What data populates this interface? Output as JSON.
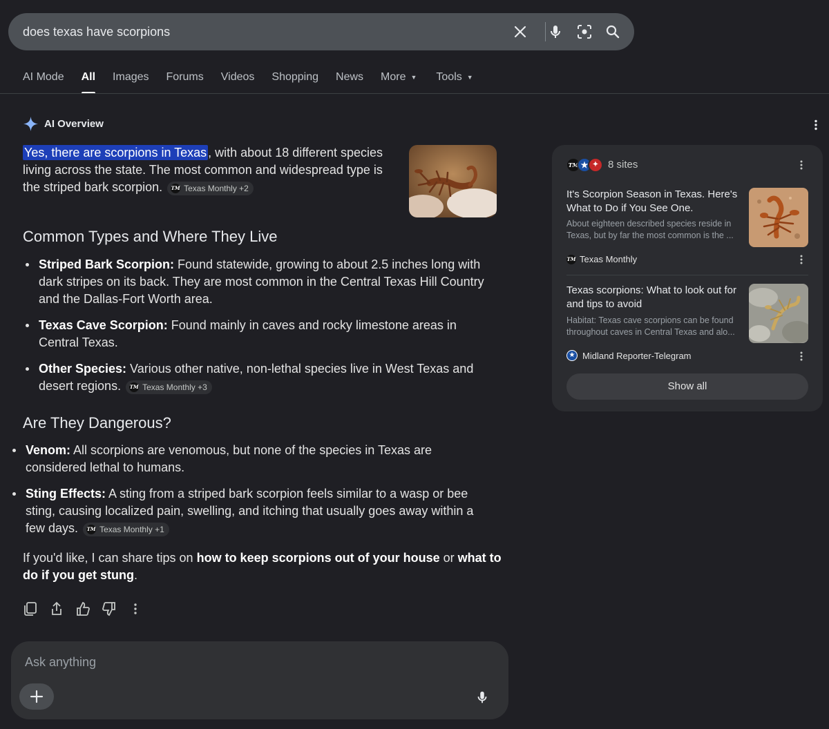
{
  "search": {
    "query": "does texas have scorpions"
  },
  "tabs": [
    {
      "label": "AI Mode"
    },
    {
      "label": "All"
    },
    {
      "label": "Images"
    },
    {
      "label": "Forums"
    },
    {
      "label": "Videos"
    },
    {
      "label": "Shopping"
    },
    {
      "label": "News"
    },
    {
      "label": "More"
    },
    {
      "label": "Tools"
    }
  ],
  "overview": {
    "title": "AI Overview",
    "intro_highlight": "Yes, there are scorpions in Texas",
    "intro_rest": ", with about 18 different species living across the state. The most common and widespread type is the striped bark scorpion.",
    "intro_cite": "Texas Monthly +2",
    "section1_title": "Common Types and Where They Live",
    "types": [
      {
        "term": "Striped Bark Scorpion:",
        "text": " Found statewide, growing to about 2.5 inches long with dark stripes on its back. They are most common in the Central Texas Hill Country and the Dallas-Fort Worth area.",
        "cite": ""
      },
      {
        "term": "Texas Cave Scorpion:",
        "text": " Found mainly in caves and rocky limestone areas in Central Texas.",
        "cite": ""
      },
      {
        "term": "Other Species:",
        "text": " Various other native, non-lethal species live in West Texas and desert regions.",
        "cite": "Texas Monthly +3"
      }
    ],
    "section2_title": "Are They Dangerous?",
    "dangers": [
      {
        "term": "Venom:",
        "text": " All scorpions are venomous, but none of the species in Texas are considered lethal to humans.",
        "cite": ""
      },
      {
        "term": "Sting Effects:",
        "text": " A sting from a striped bark scorpion feels similar to a wasp or bee sting, causing localized pain, swelling, and itching that usually goes away within a few days.",
        "cite": "Texas Monthly +1"
      }
    ],
    "closing_pre": "If you'd like, I can share tips on ",
    "closing_b1": "how to keep scorpions out of your house",
    "closing_mid": " or ",
    "closing_b2": "what to do if you get stung",
    "closing_end": "."
  },
  "ask": {
    "placeholder": "Ask anything"
  },
  "sources": {
    "count_label": "8 sites",
    "items": [
      {
        "title": "It's Scorpion Season in Texas. Here's What to Do if You See One.",
        "snippet": "About eighteen described species reside in Texas, but by far the most common is the ...",
        "source": "Texas Monthly"
      },
      {
        "title": "Texas scorpions: What to look out for and tips to avoid",
        "snippet": "Habitat: Texas cave scorpions can be found throughout caves in Central Texas and alo...",
        "source": "Midland Reporter-Telegram"
      }
    ],
    "show_all": "Show all"
  },
  "logos": {
    "tm": "TM"
  },
  "colors": {
    "background": "#1f1f24",
    "highlight": "#1d3fb8",
    "panel": "#2b2c30",
    "gemini_accent": "#8ab4f8"
  }
}
